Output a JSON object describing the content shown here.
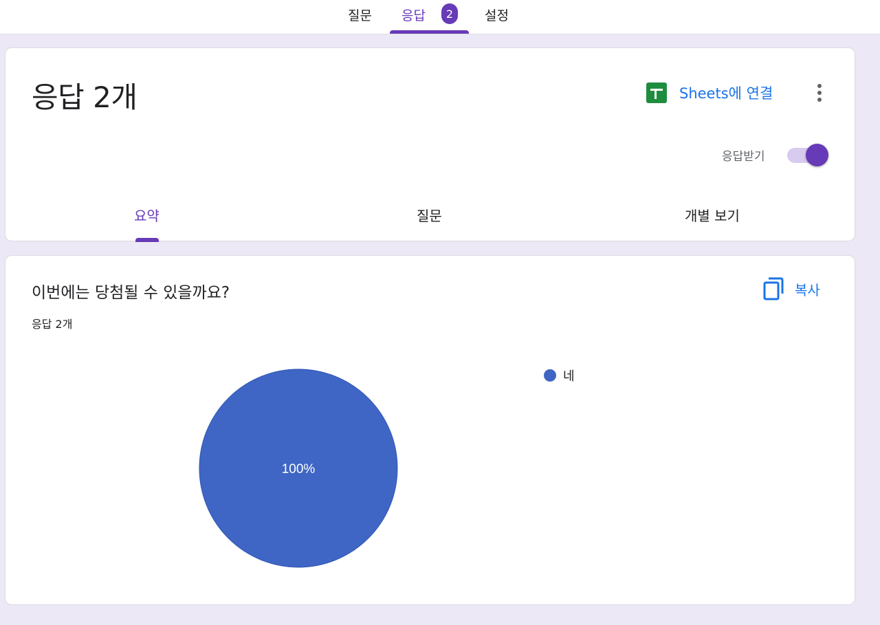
{
  "nav": {
    "tabs": [
      {
        "label": "질문"
      },
      {
        "label": "응답"
      },
      {
        "label": "설정"
      }
    ],
    "responses_badge": "2",
    "active_tab": "응답"
  },
  "header": {
    "title": "응답 2개",
    "sheets_link_label": "Sheets에 연결",
    "sheets_icon": "google-sheets-icon",
    "more_icon": "more-vert-icon",
    "accepting_label": "응답받기",
    "accepting_responses": true,
    "subtabs": [
      {
        "label": "요약"
      },
      {
        "label": "질문"
      },
      {
        "label": "개별 보기"
      }
    ],
    "active_subtab": "요약"
  },
  "question": {
    "title": "이번에는 당첨될 수 있을까요?",
    "response_count": "응답 2개",
    "copy_label": "복사",
    "copy_icon": "copy-icon"
  },
  "chart_data": {
    "type": "pie",
    "categories": [
      "네"
    ],
    "values": [
      100
    ],
    "data_labels": [
      "100%"
    ],
    "legend_position": "right",
    "colors": [
      "#3f66c4"
    ]
  },
  "colors": {
    "accent": "#673ab7",
    "link": "#1a73e8",
    "sheets_green": "#1e8e3e",
    "background": "#ede8f5"
  }
}
